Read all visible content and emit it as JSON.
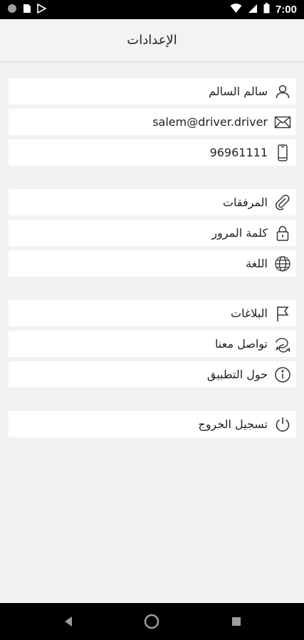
{
  "status_bar": {
    "time": "7:00",
    "icons": [
      "record-icon",
      "sim-card-icon",
      "play-store-icon",
      "wifi-icon",
      "signal-icon",
      "battery-icon"
    ]
  },
  "header": {
    "title": "الإعدادات"
  },
  "profile": {
    "name": "سالم السالم",
    "email": "salem@driver.driver",
    "phone": "96961111"
  },
  "settings": {
    "attachments": "المرفقات",
    "password": "كلمة المرور",
    "language": "اللغة"
  },
  "support": {
    "reports": "البلاغات",
    "contact": "تواصل معنا",
    "about": "حول التطبيق"
  },
  "account": {
    "logout": "تسجيل الخروج"
  },
  "nav_bar": {
    "icons": [
      "back-icon",
      "home-icon",
      "recents-icon"
    ]
  },
  "colors": {
    "background": "#f2f2f2",
    "row_background": "#ffffff",
    "text": "#222222",
    "icon": "#333333"
  }
}
